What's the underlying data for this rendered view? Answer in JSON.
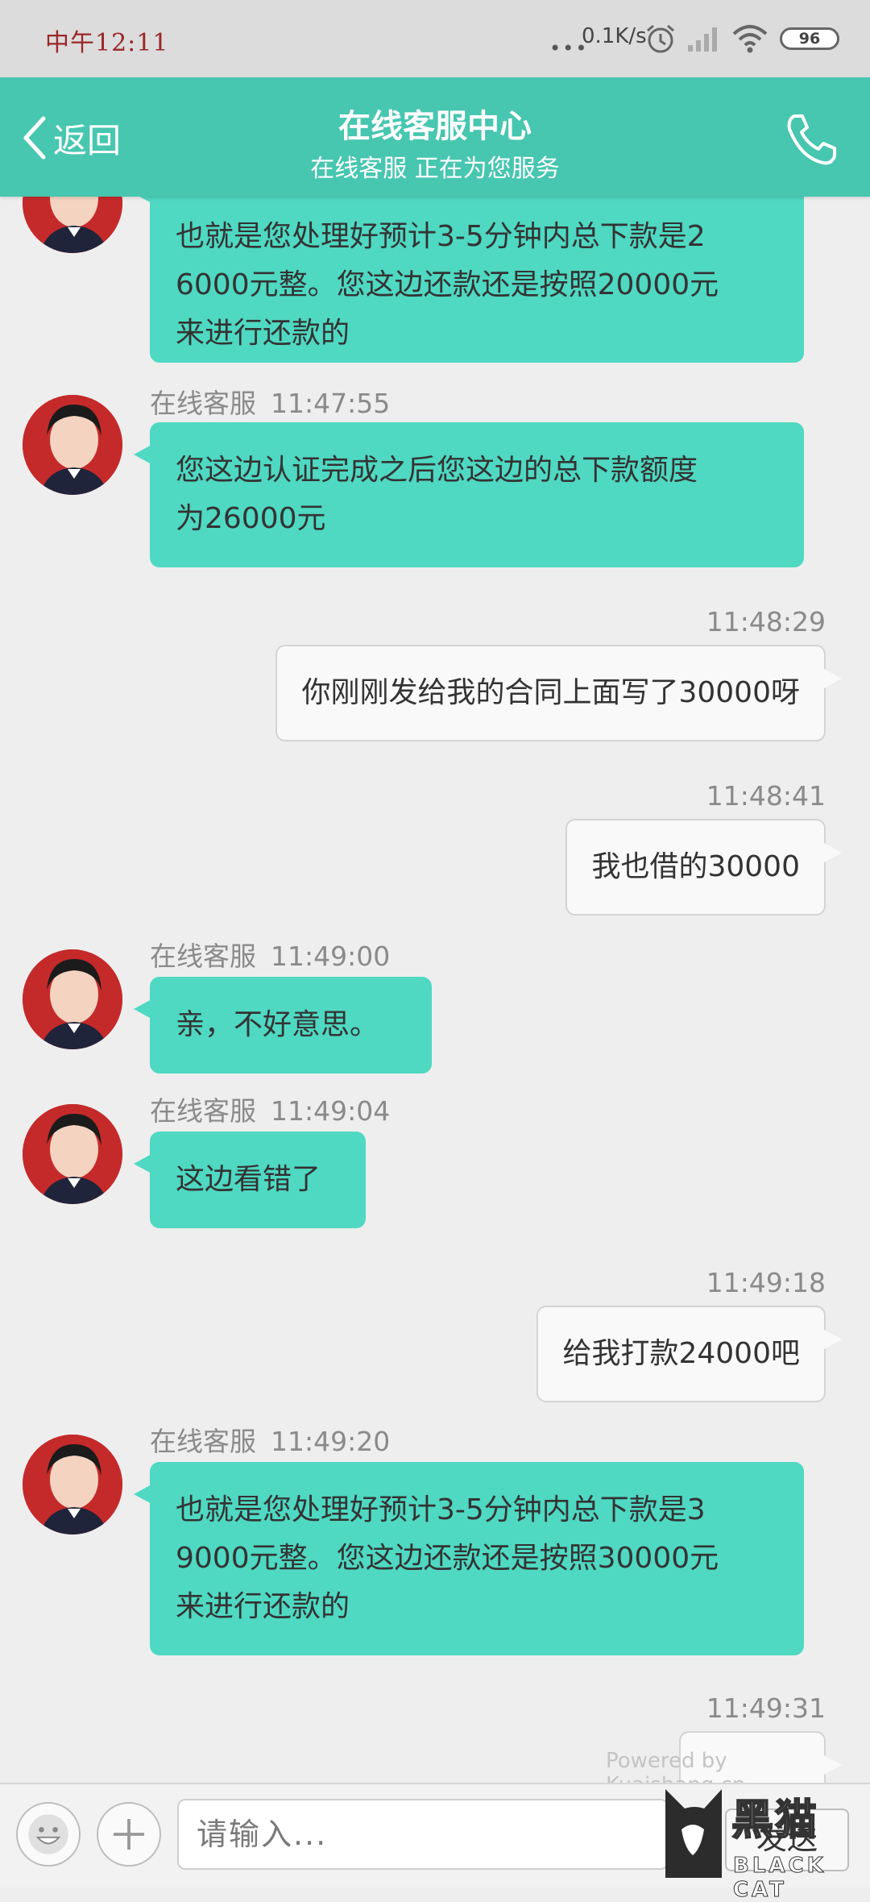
{
  "status_bar": {
    "time": "中午12:11",
    "dots": "•••",
    "net_speed": "0.1K/s",
    "battery": "96"
  },
  "header": {
    "back_label": "返回",
    "title": "在线客服中心",
    "subtitle": "在线客服 正在为您服务"
  },
  "messages": [
    {
      "side": "in",
      "sender": "",
      "time": "",
      "text": "也就是您处理好预计3-5分钟内总下款是2\n6000元整。您这边还款还是按照20000元\n来进行还款的"
    },
    {
      "side": "in",
      "sender": "在线客服",
      "time": "11:47:55",
      "text": "您这边认证完成之后您这边的总下款额度\n为26000元"
    },
    {
      "side": "out",
      "time": "11:48:29",
      "text": "你刚刚发给我的合同上面写了30000呀"
    },
    {
      "side": "out",
      "time": "11:48:41",
      "text": "我也借的30000"
    },
    {
      "side": "in",
      "sender": "在线客服",
      "time": "11:49:00",
      "text": "亲，不好意思。"
    },
    {
      "side": "in",
      "sender": "在线客服",
      "time": "11:49:04",
      "text": "这边看错了"
    },
    {
      "side": "out",
      "time": "11:49:18",
      "text": "给我打款24000吧"
    },
    {
      "side": "in",
      "sender": "在线客服",
      "time": "11:49:20",
      "text": "也就是您处理好预计3-5分钟内总下款是3\n9000元整。您这边还款还是按照30000元\n来进行还款的"
    },
    {
      "side": "out",
      "time": "11:49:31",
      "text": ""
    }
  ],
  "powered_by": "Powered by Kuaishang.cn",
  "input": {
    "placeholder": "请输入...",
    "send_label": "发送"
  },
  "watermark": {
    "text": "黑猫",
    "sub": "BLACK CAT"
  },
  "colors": {
    "header": "#47c6b0",
    "agent_bubble": "#4fd8c2",
    "user_bubble": "#f9f9f9"
  },
  "icons": [
    "back-chevron-icon",
    "phone-icon",
    "emoji-icon",
    "plus-icon",
    "alarm-icon",
    "signal-icon",
    "wifi-icon",
    "battery-icon",
    "cat-logo-icon"
  ]
}
